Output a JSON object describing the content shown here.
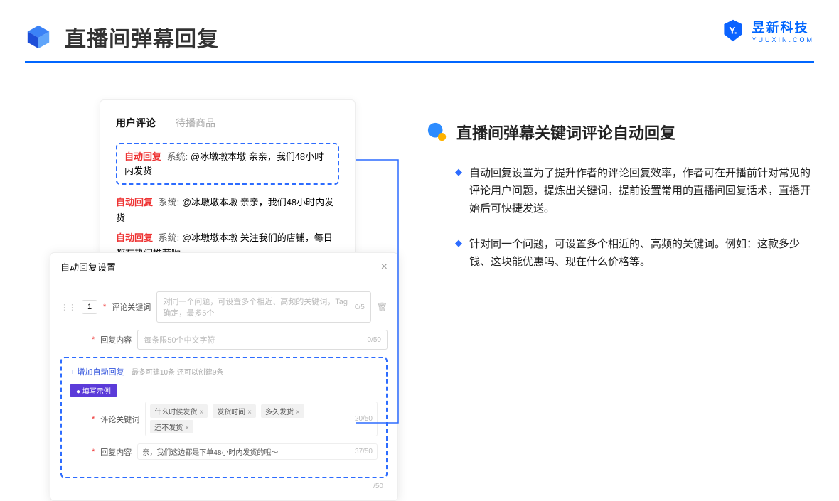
{
  "header": {
    "title": "直播间弹幕回复",
    "brand_name": "昱新科技",
    "brand_sub": "YUUXIN.COM"
  },
  "panel1": {
    "tab_active": "用户评论",
    "tab_inactive": "待播商品",
    "badge": "自动回复",
    "sys": "系统:",
    "hl_text": "@冰墩墩本墩 亲亲，我们48小时内发货",
    "r2": "@冰墩墩本墩 亲亲，我们48小时内发货",
    "r3": "@冰墩墩本墩 关注我们的店铺，每日都有热门推荐呦～"
  },
  "panel2": {
    "title": "自动回复设置",
    "num": "1",
    "lbl1": "评论关键词",
    "ph1": "对同一个问题，可设置多个相近、高频的关键词，Tag确定，最多5个",
    "cnt1": "0/5",
    "lbl2": "回复内容",
    "ph2": "每条限50个中文字符",
    "cnt2": "0/50",
    "add": "+ 增加自动回复",
    "add_note": "最多可建10条 还可以创建9条",
    "pill": "● 填写示例",
    "ex_lbl1": "评论关键词",
    "tags": [
      "什么时候发货",
      "发货时间",
      "多久发货",
      "还不发货"
    ],
    "ex_cnt1": "20/50",
    "ex_lbl2": "回复内容",
    "ex_val": "亲，我们这边都是下单48小时内发货的哦～",
    "ex_cnt2": "37/50",
    "tail_cnt": "/50"
  },
  "right": {
    "title": "直播间弹幕关键词评论自动回复",
    "b1": "自动回复设置为了提升作者的评论回复效率，作者可在开播前针对常见的评论用户问题，提炼出关键词，提前设置常用的直播间回复话术，直播开始后可快捷发送。",
    "b2": "针对同一个问题，可设置多个相近的、高频的关键词。例如：这款多少钱、这块能优惠吗、现在什么价格等。"
  }
}
